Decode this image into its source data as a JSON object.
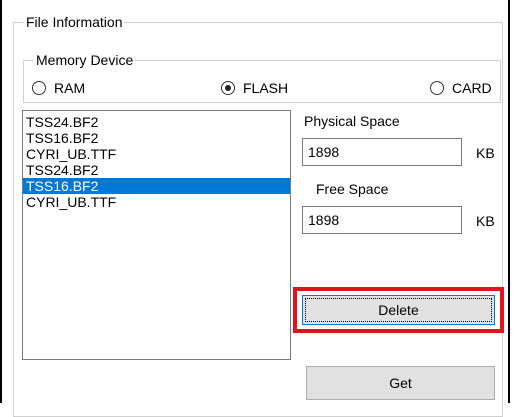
{
  "file_info": {
    "title": "File Information",
    "memory_device": {
      "title": "Memory Device",
      "options": [
        {
          "label": "RAM",
          "checked": false
        },
        {
          "label": "FLASH",
          "checked": true
        },
        {
          "label": "CARD",
          "checked": false
        }
      ]
    },
    "files": [
      {
        "name": "TSS24.BF2",
        "selected": false
      },
      {
        "name": "TSS16.BF2",
        "selected": false
      },
      {
        "name": "CYRI_UB.TTF",
        "selected": false
      },
      {
        "name": "TSS24.BF2",
        "selected": false
      },
      {
        "name": "TSS16.BF2",
        "selected": true
      },
      {
        "name": "CYRI_UB.TTF",
        "selected": false
      }
    ],
    "physical_space": {
      "label": "Physical Space",
      "value": "1898",
      "unit": "KB"
    },
    "free_space": {
      "label": "Free Space",
      "value": "1898",
      "unit": "KB"
    },
    "delete_label": "Delete",
    "get_label": "Get",
    "highlight_color": "#e3101e",
    "selection_color": "#0078d7"
  }
}
